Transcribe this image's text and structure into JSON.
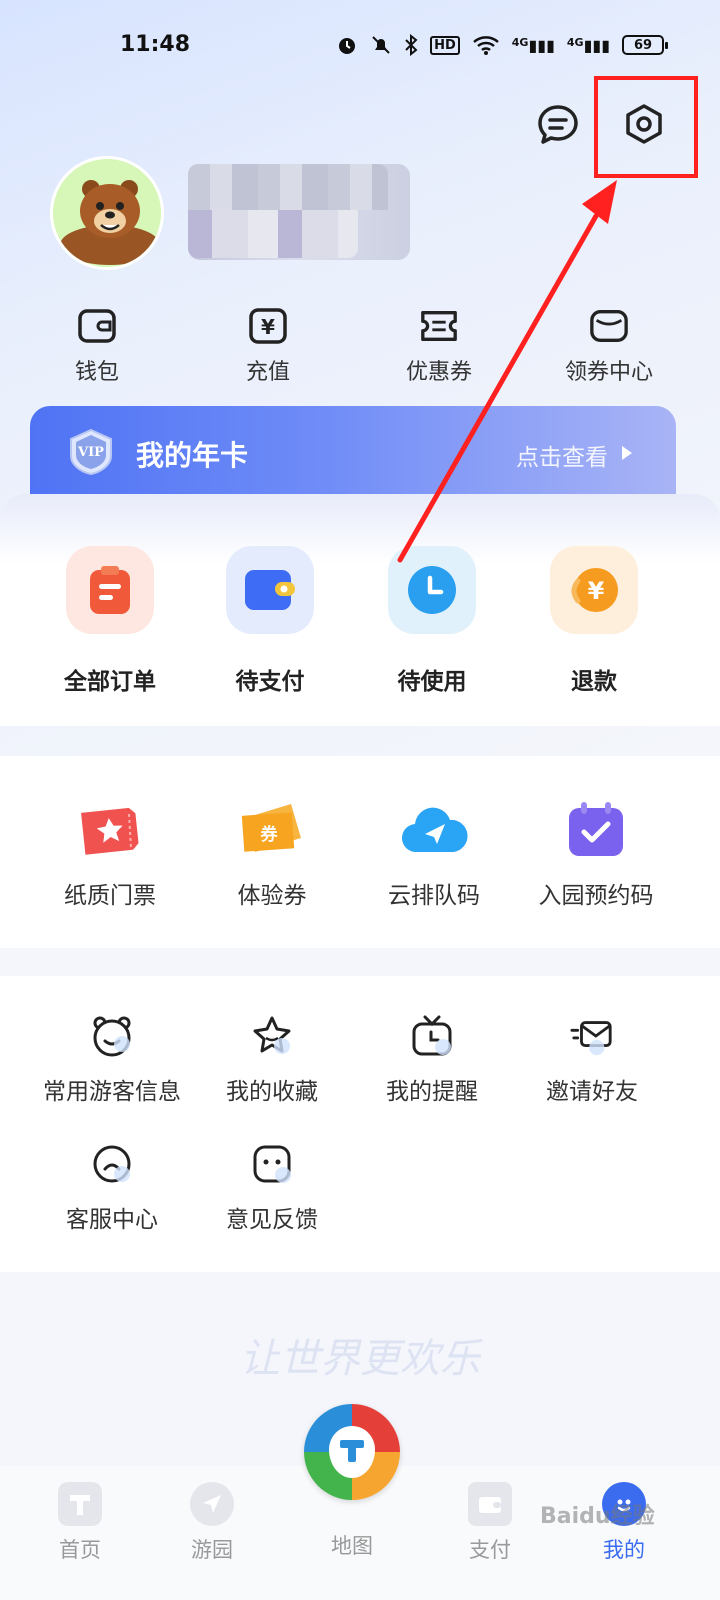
{
  "status_bar": {
    "time": "11:48",
    "battery": "69",
    "signal_1": "4G",
    "signal_2": "4G",
    "hd": "HD"
  },
  "header": {
    "message_icon": "message-icon",
    "settings_icon": "settings-icon"
  },
  "quick_actions": [
    {
      "label": "钱包",
      "icon": "wallet-icon"
    },
    {
      "label": "充值",
      "icon": "recharge-icon"
    },
    {
      "label": "优惠券",
      "icon": "coupon-icon"
    },
    {
      "label": "领券中心",
      "icon": "coupon-center-icon"
    }
  ],
  "vip": {
    "title": "我的年卡",
    "more": "点击查看",
    "badge": "VIP"
  },
  "orders": [
    {
      "label": "全部订单",
      "icon": "all-orders-icon",
      "color": "#f0593a"
    },
    {
      "label": "待支付",
      "icon": "pending-payment-icon",
      "color": "#3e6cf5"
    },
    {
      "label": "待使用",
      "icon": "pending-use-icon",
      "color": "#2a9ff0"
    },
    {
      "label": "退款",
      "icon": "refund-icon",
      "color": "#f59b1f"
    }
  ],
  "tickets": [
    {
      "label": "纸质门票",
      "icon": "paper-ticket-icon",
      "color": "#f0524f"
    },
    {
      "label": "体验券",
      "icon": "experience-voucher-icon",
      "color": "#f7a420"
    },
    {
      "label": "云排队码",
      "icon": "cloud-queue-icon",
      "color": "#2aa4f4"
    },
    {
      "label": "入园预约码",
      "icon": "park-reservation-icon",
      "color": "#7a62ee"
    }
  ],
  "tools": [
    {
      "label": "常用游客信息",
      "icon": "visitor-info-icon"
    },
    {
      "label": "我的收藏",
      "icon": "favorites-icon"
    },
    {
      "label": "我的提醒",
      "icon": "reminder-icon"
    },
    {
      "label": "邀请好友",
      "icon": "invite-friends-icon"
    },
    {
      "label": "客服中心",
      "icon": "customer-service-icon"
    },
    {
      "label": "意见反馈",
      "icon": "feedback-icon"
    }
  ],
  "slogan": "让世界更欢乐",
  "bottom_nav": [
    {
      "label": "首页",
      "icon": "home-icon"
    },
    {
      "label": "游园",
      "icon": "park-tour-icon"
    },
    {
      "label": "地图",
      "icon": "map-icon"
    },
    {
      "label": "支付",
      "icon": "payment-icon"
    },
    {
      "label": "我的",
      "icon": "mine-icon",
      "active": true
    }
  ],
  "watermark": "Baidu经验"
}
